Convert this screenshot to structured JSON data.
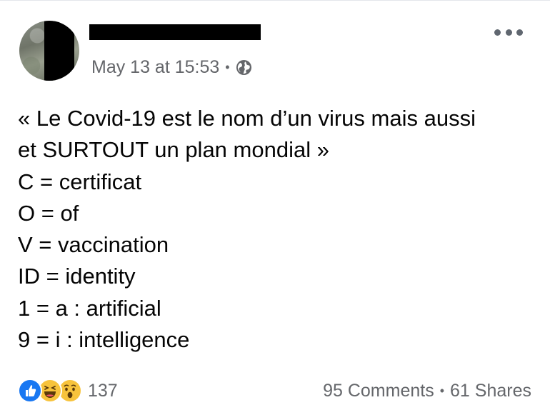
{
  "post": {
    "timestamp": "May 13 at 15:53",
    "separator": "•",
    "privacy_icon": "globe-icon",
    "body_lines": [
      "« Le Covid-19 est le nom d’un virus mais aussi",
      "et SURTOUT un plan mondial »",
      "C = certificat",
      "O = of",
      "V = vaccination",
      "ID = identity",
      "1 = a : artificial",
      "9 = i : intelligence"
    ]
  },
  "reactions": {
    "icons": [
      "like-icon",
      "haha-icon",
      "wow-icon"
    ],
    "count": "137"
  },
  "engagement": {
    "comments": "95 Comments",
    "separator": "•",
    "shares": "61 Shares"
  },
  "colors": {
    "text_primary": "#050505",
    "text_secondary": "#65676b",
    "like_blue": "#1877f2",
    "reaction_yellow": "#f7c33c"
  }
}
